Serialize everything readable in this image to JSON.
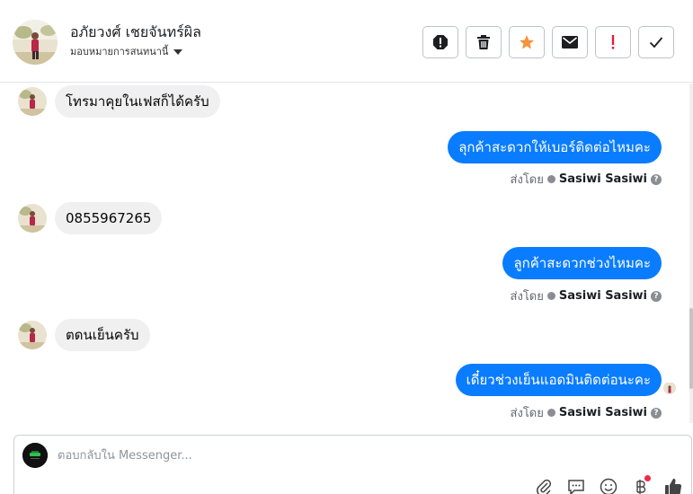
{
  "header": {
    "contact_name": "อภัยวงศ์ เชยจันทร์ผิล",
    "assign_label": "มอบหมายการสนทนานี้",
    "actions": [
      {
        "name": "spam-icon",
        "color": "#1c1e21"
      },
      {
        "name": "trash-icon",
        "color": "#1c1e21"
      },
      {
        "name": "star-icon",
        "color": "#f7923b"
      },
      {
        "name": "envelope-icon",
        "color": "#1c1e21"
      },
      {
        "name": "exclamation-icon",
        "color": "#e41e3f"
      },
      {
        "name": "checkmark-icon",
        "color": "#1c1e21"
      }
    ]
  },
  "messages": [
    {
      "direction": "in",
      "text": "โทรมาคุยในเฟสก็ได้ครับ"
    },
    {
      "direction": "out",
      "text": "ลุกค้าสะดวกให้เบอร์ติดต่อไหมคะ",
      "sent_by_label": "ส่งโดย",
      "sender": "Sasiwi Sasiwi"
    },
    {
      "direction": "in",
      "text": "0855967265"
    },
    {
      "direction": "out",
      "text": "ลูกค้าสะดวกช่วงไหมคะ",
      "sent_by_label": "ส่งโดย",
      "sender": "Sasiwi Sasiwi"
    },
    {
      "direction": "in",
      "text": "ตดนเย็นครับ"
    },
    {
      "direction": "out",
      "text": "เดี๋ยวช่วงเย็นแอดมินติดต่อนะคะ",
      "sent_by_label": "ส่งโดย",
      "sender": "Sasiwi Sasiwi"
    }
  ],
  "composer": {
    "placeholder": "ตอบกลับใน Messenger...",
    "tools": [
      "paperclip-icon",
      "saved-reply-icon",
      "emoji-icon",
      "baht-icon",
      "thumbs-up-icon"
    ]
  },
  "colors": {
    "outgoing_bubble": "#0a7cff",
    "incoming_bubble": "#f0f0f0",
    "star": "#f7923b",
    "alert": "#e41e3f"
  }
}
